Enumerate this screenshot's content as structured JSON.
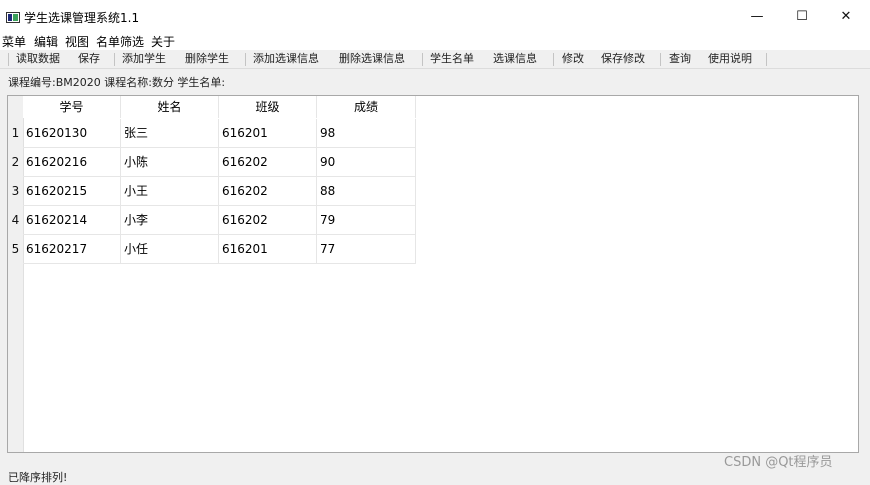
{
  "window": {
    "title": "学生选课管理系统1.1",
    "min_glyph": "—",
    "max_glyph": "☐",
    "close_glyph": "✕"
  },
  "menu": [
    "菜单",
    "编辑",
    "视图",
    "名单筛选",
    "关于"
  ],
  "toolbar": [
    "读取数据",
    "保存",
    "添加学生",
    "删除学生",
    "添加选课信息",
    "删除选课信息",
    "学生名单",
    "选课信息",
    "修改",
    "保存修改",
    "查询",
    "使用说明"
  ],
  "info": "课程编号:BM2020 课程名称:数分 学生名单:",
  "table": {
    "headers": [
      "学号",
      "姓名",
      "班级",
      "成绩"
    ],
    "rows": [
      {
        "num": "1",
        "id": "61620130",
        "name": "张三",
        "class": "616201",
        "score": "98"
      },
      {
        "num": "2",
        "id": "61620216",
        "name": "小陈",
        "class": "616202",
        "score": "90"
      },
      {
        "num": "3",
        "id": "61620215",
        "name": "小王",
        "class": "616202",
        "score": "88"
      },
      {
        "num": "4",
        "id": "61620214",
        "name": "小李",
        "class": "616202",
        "score": "79"
      },
      {
        "num": "5",
        "id": "61620217",
        "name": "小任",
        "class": "616201",
        "score": "77"
      }
    ]
  },
  "status": "已降序排列!",
  "watermark": "CSDN @Qt程序员"
}
